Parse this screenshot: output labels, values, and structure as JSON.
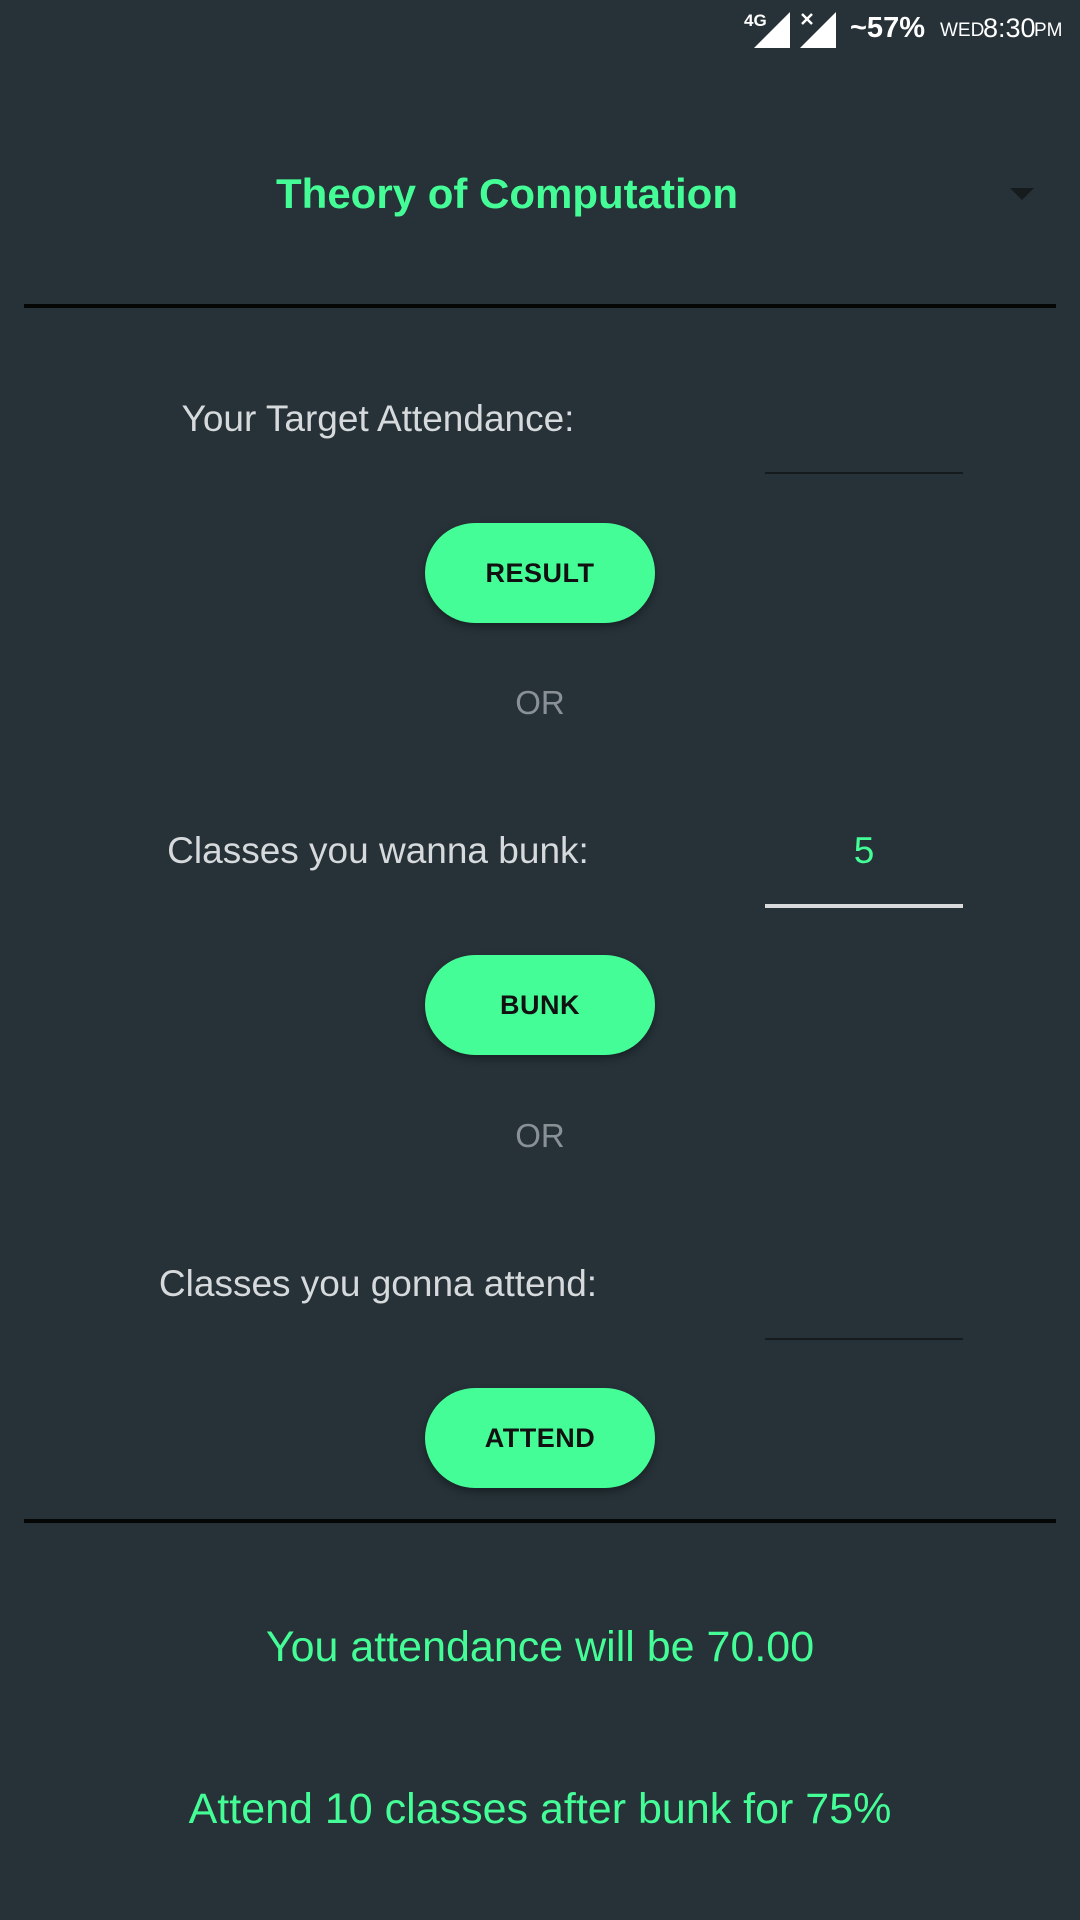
{
  "status_bar": {
    "network": "4G",
    "battery": "~57%",
    "day": "WED",
    "time": "8:30",
    "ampm": "PM"
  },
  "subject_spinner": {
    "selected": "Theory of Computation"
  },
  "target_attendance": {
    "label": "Your Target Attendance:",
    "value": ""
  },
  "result_button": {
    "label": "RESULT"
  },
  "or_1": "OR",
  "bunk_classes": {
    "label": "Classes you wanna bunk:",
    "value": "5"
  },
  "bunk_button": {
    "label": "BUNK"
  },
  "or_2": "OR",
  "attend_classes": {
    "label": "Classes you gonna attend:",
    "value": ""
  },
  "attend_button": {
    "label": "ATTEND"
  },
  "results": {
    "line1": "You attendance will be 70.00",
    "line2": "Attend 10 classes after bunk for 75%"
  },
  "colors": {
    "background": "#263238",
    "accent": "#45fd97",
    "divider": "#050606"
  },
  "icons": [
    "signal-icon",
    "no-signal-icon",
    "dropdown-arrow-icon"
  ]
}
